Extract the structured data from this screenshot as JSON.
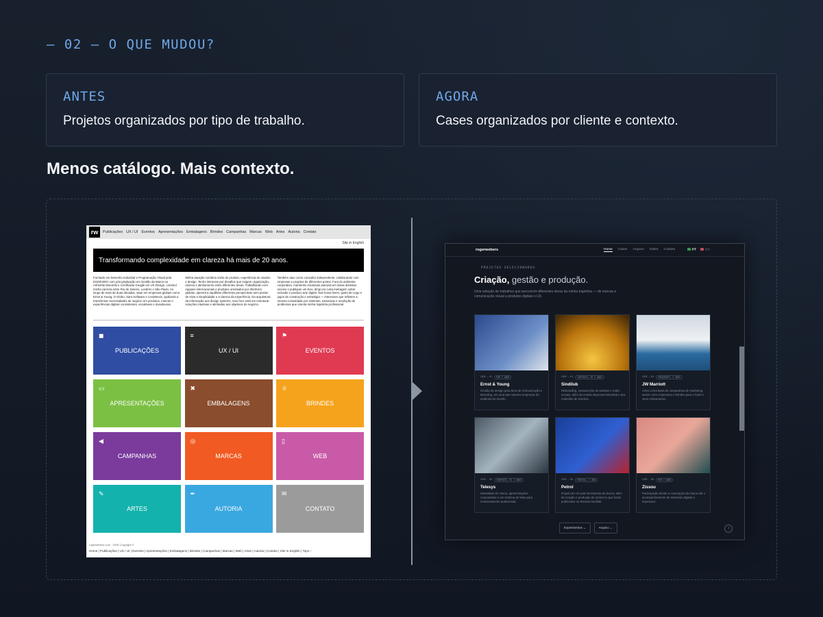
{
  "header": {
    "kicker": "— 02 — O QUE MUDOU?"
  },
  "cards": [
    {
      "label": "ANTES",
      "text": "Projetos organizados por tipo de trabalho."
    },
    {
      "label": "AGORA",
      "text": "Cases organizados por cliente e contexto."
    }
  ],
  "headline": "Menos catálogo. Mais contexto.",
  "old_site": {
    "nav": [
      "Publicações",
      "UX / UI",
      "Eventos",
      "Apresentações",
      "Embalagens",
      "Brindes",
      "Campanhas",
      "Marcas",
      "Web",
      "Artes",
      "Autoria",
      "Contato"
    ],
    "english_link": "Site in English",
    "hero": "Transformando complexidade em clareza há mais de 20 anos.",
    "col1": "Formado em Desenho Industrial e Programação Visual pela ESDI/UERJ com pós-graduação em Gestão da Marca na Anhembi Morumbi e Certificado Google em UX Design, construí minha carreira entre Rio de Janeiro, Londres e São Paulo. Ao longo de mais de duas décadas, atuei em empresas globais como Ernst & Young, O Globo, Xara Software e LexisNexis, ajudando a transformar necessidades de negócio em produtos, marcas e experiências digitais consistentes, escaláveis e duradouras.",
    "col2": "Minha atuação combina visão de produto, experiência do usuário e design. Tenho interesse por desafios que exigem organização, clareza e alinhamento entre diferentes áreas. Trabalhando com equipes internacionais e produtos orientados por diretrizes globais, aprendi a equilibrar diferentes perspectivas sem perder de vista a simplicidade e a clareza da experiência. Da arquitetura da informação aos design systems, meu foco está em estruturar soluções intuitivas e alinhadas aos objetivos do negócio.",
    "col3": "Também atuo como consultor independente, colaborando com empresas e projetos de diferentes portes. Fora do ambiente corporativo, mantenho iniciativas autorais em áreas distintas: escrevi e publiquei um livro, dirigi um curta-metragem sobre inclusão e produzo arte digital. Nas horas livres, gosto de Lego e jogos de construção e estratégia — interesses que refletem a mesma curiosidade por sistemas, estruturas e resolução de problemas que orienta minha trajetória profissional.",
    "tiles": [
      {
        "label": "PUBLICAÇÕES",
        "color": "#2f4da3",
        "icon": "◼"
      },
      {
        "label": "UX / UI",
        "color": "#2b2b2b",
        "icon": "≡"
      },
      {
        "label": "EVENTOS",
        "color": "#e03a52",
        "icon": "⚑"
      },
      {
        "label": "APRESENTAÇÕES",
        "color": "#7bc043",
        "icon": "▭"
      },
      {
        "label": "EMBALAGENS",
        "color": "#8a4d2d",
        "icon": "✖"
      },
      {
        "label": "BRINDES",
        "color": "#f5a31c",
        "icon": "♕"
      },
      {
        "label": "CAMPANHAS",
        "color": "#7a3b9c",
        "icon": "◀"
      },
      {
        "label": "MARCAS",
        "color": "#f15a22",
        "icon": "◎"
      },
      {
        "label": "WEB",
        "color": "#c95aa8",
        "icon": "▯"
      },
      {
        "label": "ARTES",
        "color": "#14b2ad",
        "icon": "✎"
      },
      {
        "label": "AUTORIA",
        "color": "#3aa8e0",
        "icon": "✒"
      },
      {
        "label": "CONTATO",
        "color": "#9b9b9b",
        "icon": "✉"
      }
    ],
    "footer_copy": "rogerwebers.com · 2026 Copyright ©",
    "footer_links": "Home | Publicações | UX / UI | Eventos | Apresentações | Embalagens | Brindes | Campanhas | Marcas | Web | Artes | Autoria | Contato | Site in English | Topo ↑"
  },
  "new_site": {
    "brand": "rogerwebers",
    "menu": [
      "Home",
      "Cases",
      "Arquivo",
      "Sobre",
      "Contato"
    ],
    "lang": [
      "PT",
      "EN"
    ],
    "kicker": "PROJETOS SELECIONADOS",
    "title_bold": "Criação,",
    "title_rest": " gestão e produção.",
    "subtitle": "Uma seleção de trabalhos que percorrem diferentes áreas da minha trajetória — de marcas e comunicação visual a produtos digitais e UX.",
    "cases": [
      {
        "name": "Ernst & Young",
        "tag1": "CASE — 01",
        "tag2": "POR 2 ANOS",
        "desc": "Gestão de design para área de Comunicação e Branding, em uma das maiores empresas de auditoria do mundo.",
        "bg": "linear-gradient(135deg,#2b4a8f,#6d8fc7 60%,#dfe4ea)"
      },
      {
        "name": "Sindilub",
        "tag1": "CASE — 01",
        "tag2": "CONTRATO, 03 E ANOS",
        "desc": "Rebranding, manutenção do website e redes sociais, além da revista impressa bimestral e dos materiais de eventos.",
        "bg": "radial-gradient(circle at 50% 80%,#f4c542,#b9740d 55%,#3b2406)"
      },
      {
        "name": "JW Marriott",
        "tag1": "CASE — 03",
        "tag2": "FREQUENTE, 3 ANOS",
        "desc": "Artes conceituais de campanhas de marketing, assim como impressos e brindes para o hotel e seus restaurantes.",
        "bg": "linear-gradient(180deg,#cfd8e0,#eef1f3 45%,#2a6aa0 70%,#1f4f7a)"
      },
      {
        "name": "Telesys",
        "tag1": "CASE — 04",
        "tag2": "CONTRATO, 02 2 ANOS",
        "desc": "Identidade de marca, apresentações corporativas e um sistema de telas para monitoramento audiovisual.",
        "bg": "linear-gradient(135deg,#4c5a66,#a4b4bf 50%,#2c3640)"
      },
      {
        "name": "Petrol",
        "tag1": "CASE — 05",
        "tag2": "PONTUAL, 1 ANO",
        "desc": "Projeto de UX para ferramenta de busca, além da criação e produção de anúncios que foram publicados na Revista Sindilub.",
        "bg": "linear-gradient(135deg,#1a3f9a,#2f5fd1 55%,#b8222c)"
      },
      {
        "name": "Zissou",
        "tag1": "CASE — 06",
        "tag2": "POR 2 ANOS",
        "desc": "Participação desde a concepção da marca até o acompanhamento de materiais digitais e impressos.",
        "bg": "linear-gradient(135deg,#d98882,#e9a79a 50%,#1f4d4f)"
      }
    ],
    "buttons": [
      "Experimentos ⌄",
      "Arquivo ⌄"
    ],
    "fab": "↑"
  }
}
